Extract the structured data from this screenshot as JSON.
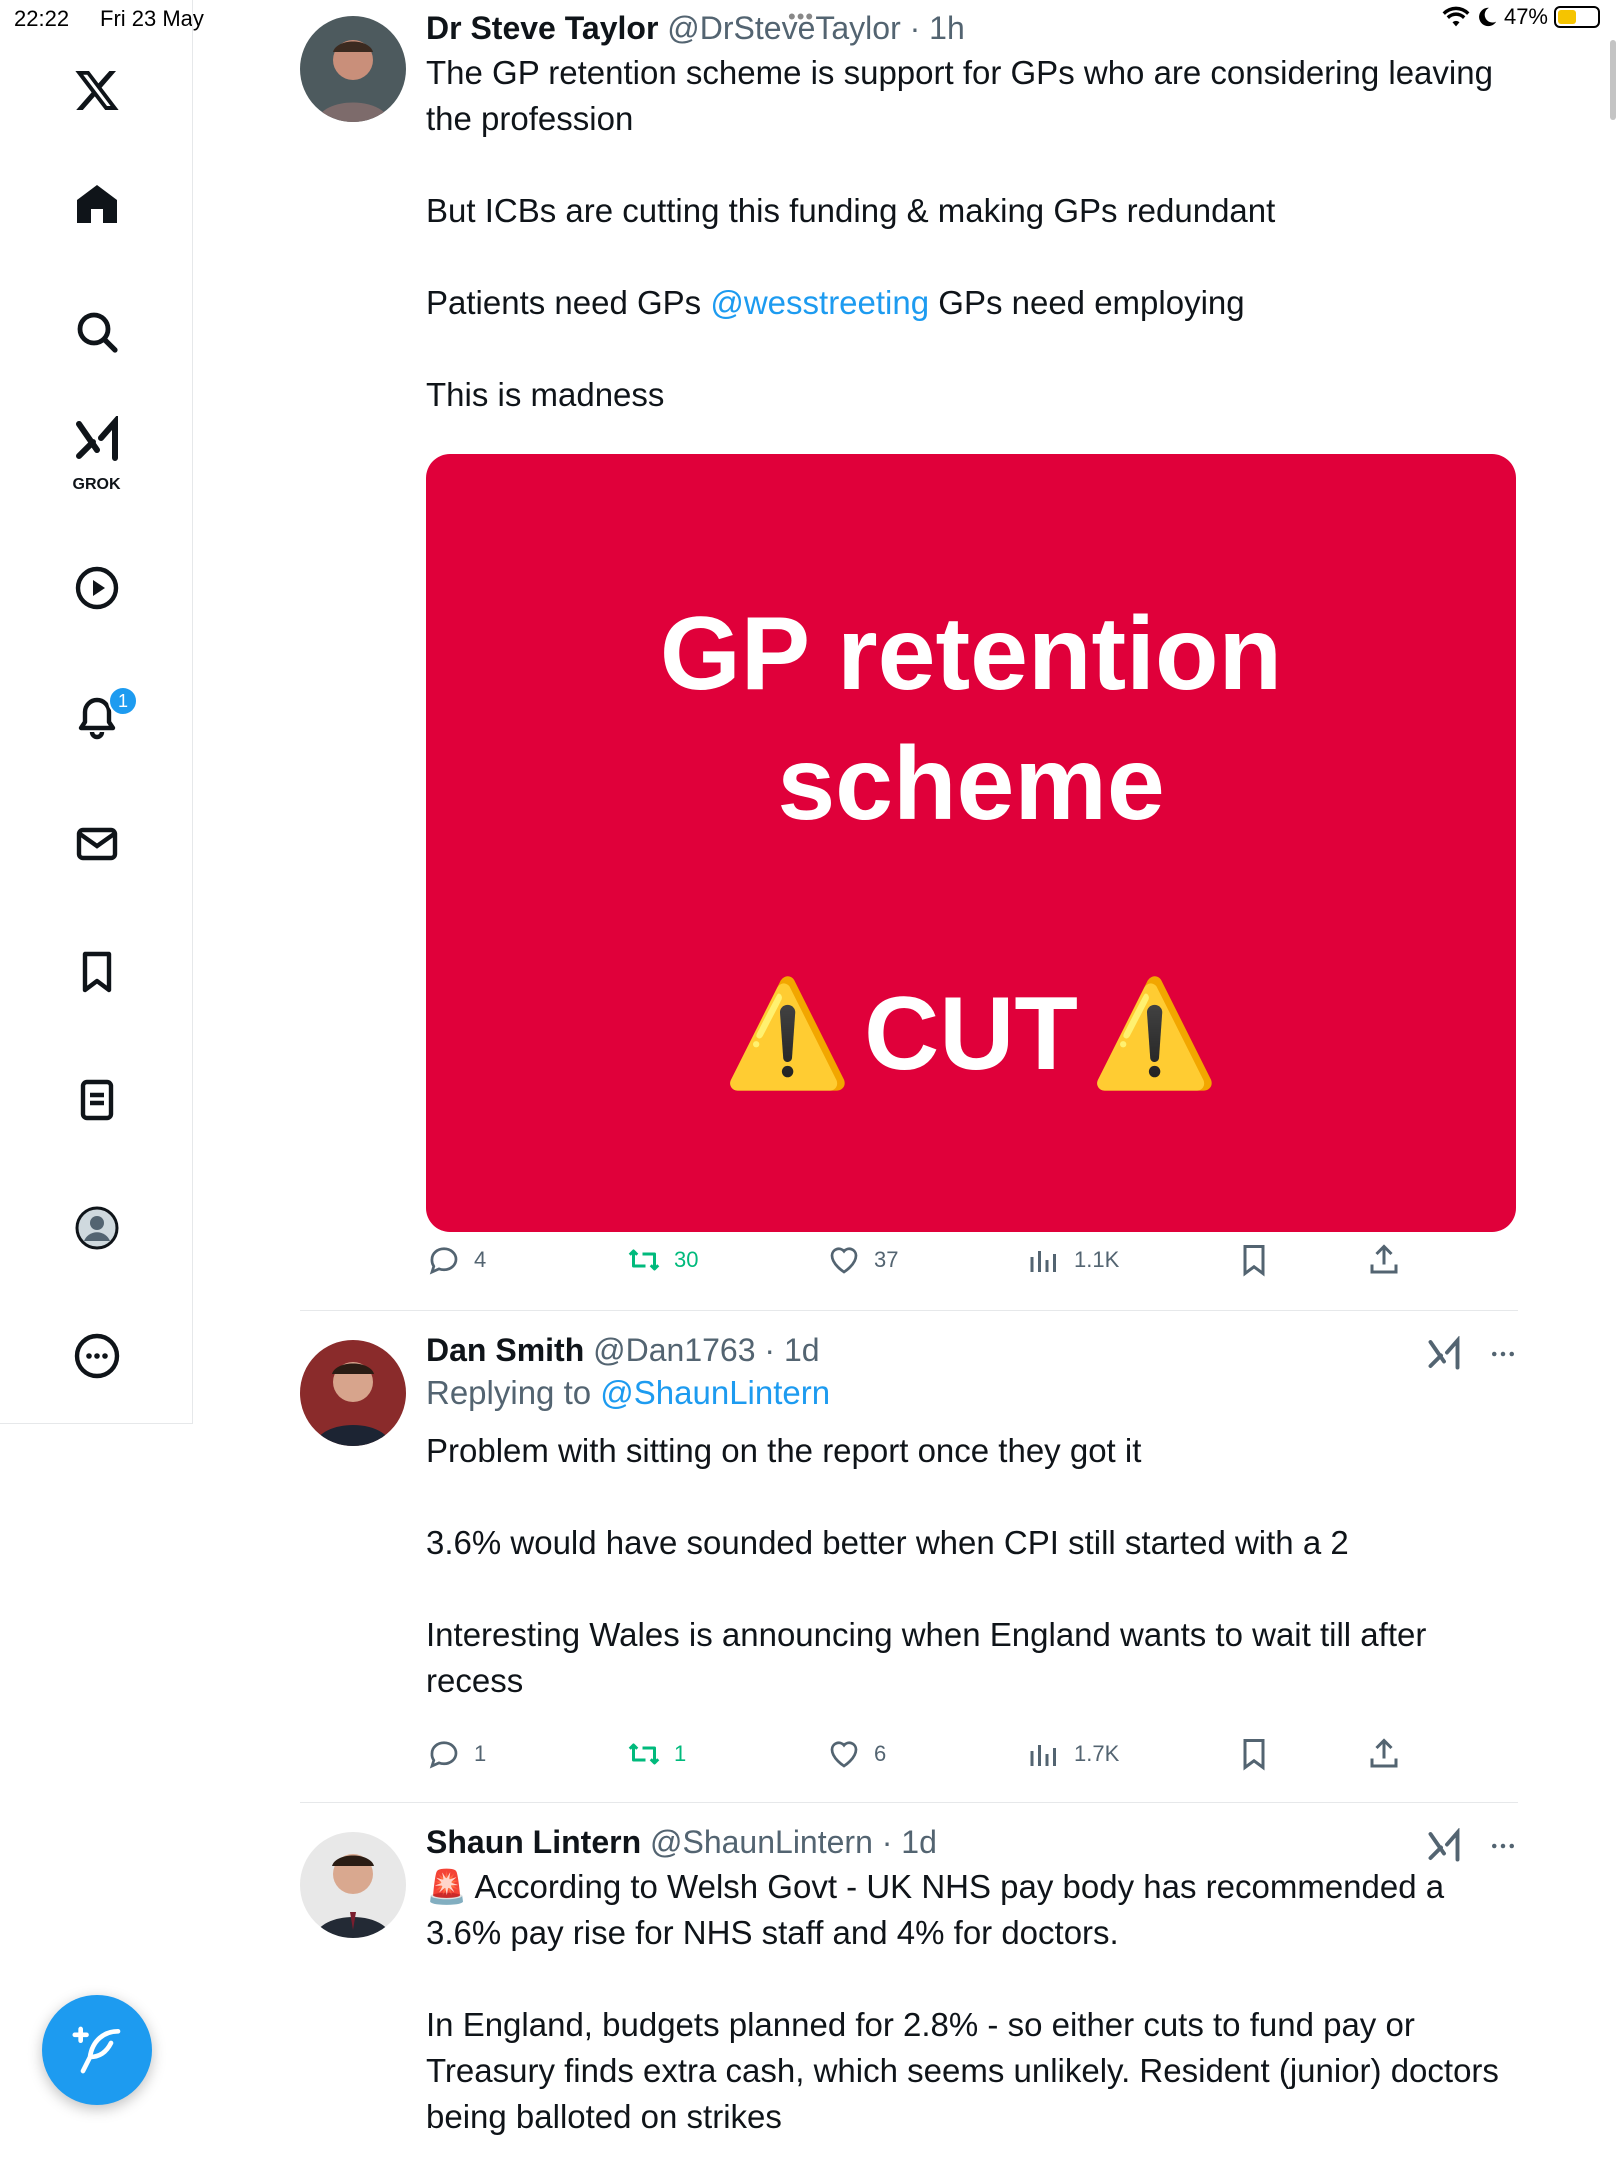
{
  "status_bar": {
    "time": "22:22",
    "date": "Fri 23 May",
    "battery": "47%",
    "battery_level": 0.47
  },
  "sidebar": {
    "grok_label": "GROK",
    "notification_count": "1",
    "items": [
      "x-logo",
      "home",
      "search",
      "grok",
      "video",
      "notifications",
      "messages",
      "bookmarks",
      "lists",
      "profile",
      "more"
    ]
  },
  "tweets": [
    {
      "name": "Dr Steve Taylor",
      "handle": "@DrSteveTaylor",
      "time": "· 1h",
      "text_parts": {
        "p1": "The GP retention scheme is support for GPs who are considering leaving the profession",
        "p2": "But ICBs are cutting this funding & making GPs redundant",
        "p3_before": "Patients need GPs ",
        "p3_mention": "@wesstreeting",
        "p3_after": " GPs need employing",
        "p4": "This is madness"
      },
      "media": {
        "line1": "GP retention",
        "line2": "scheme",
        "line3": "CUT",
        "warning_glyph": "⚠️",
        "background": "#e0003a"
      },
      "stats": {
        "replies": "4",
        "retweets": "30",
        "likes": "37",
        "views": "1.1K"
      }
    },
    {
      "name": "Dan Smith",
      "handle": "@Dan1763",
      "time": "· 1d",
      "replying_label": "Replying to ",
      "replying_to": "@ShaunLintern",
      "text_parts": {
        "p1": "Problem with sitting on the report once they got it",
        "p2": "3.6% would have sounded better when CPI still started with a 2",
        "p3": "Interesting Wales is announcing when England wants to wait till after recess"
      },
      "stats": {
        "replies": "1",
        "retweets": "1",
        "likes": "6",
        "views": "1.7K"
      }
    },
    {
      "name": "Shaun Lintern",
      "handle": "@ShaunLintern",
      "time": "· 1d",
      "text_parts": {
        "siren": "🚨",
        "p1": "According to Welsh Govt - UK NHS pay body has recommended a 3.6% pay rise for NHS staff and 4% for doctors.",
        "p2": "In England, budgets planned for 2.8% - so either cuts to fund pay or Treasury finds extra cash, which seems unlikely. Resident (junior) doctors being balloted on strikes"
      }
    }
  ],
  "colors": {
    "accent": "#1d9bf0",
    "retweet": "#00ba7c",
    "muted": "#536471",
    "media_red": "#e0003a"
  }
}
